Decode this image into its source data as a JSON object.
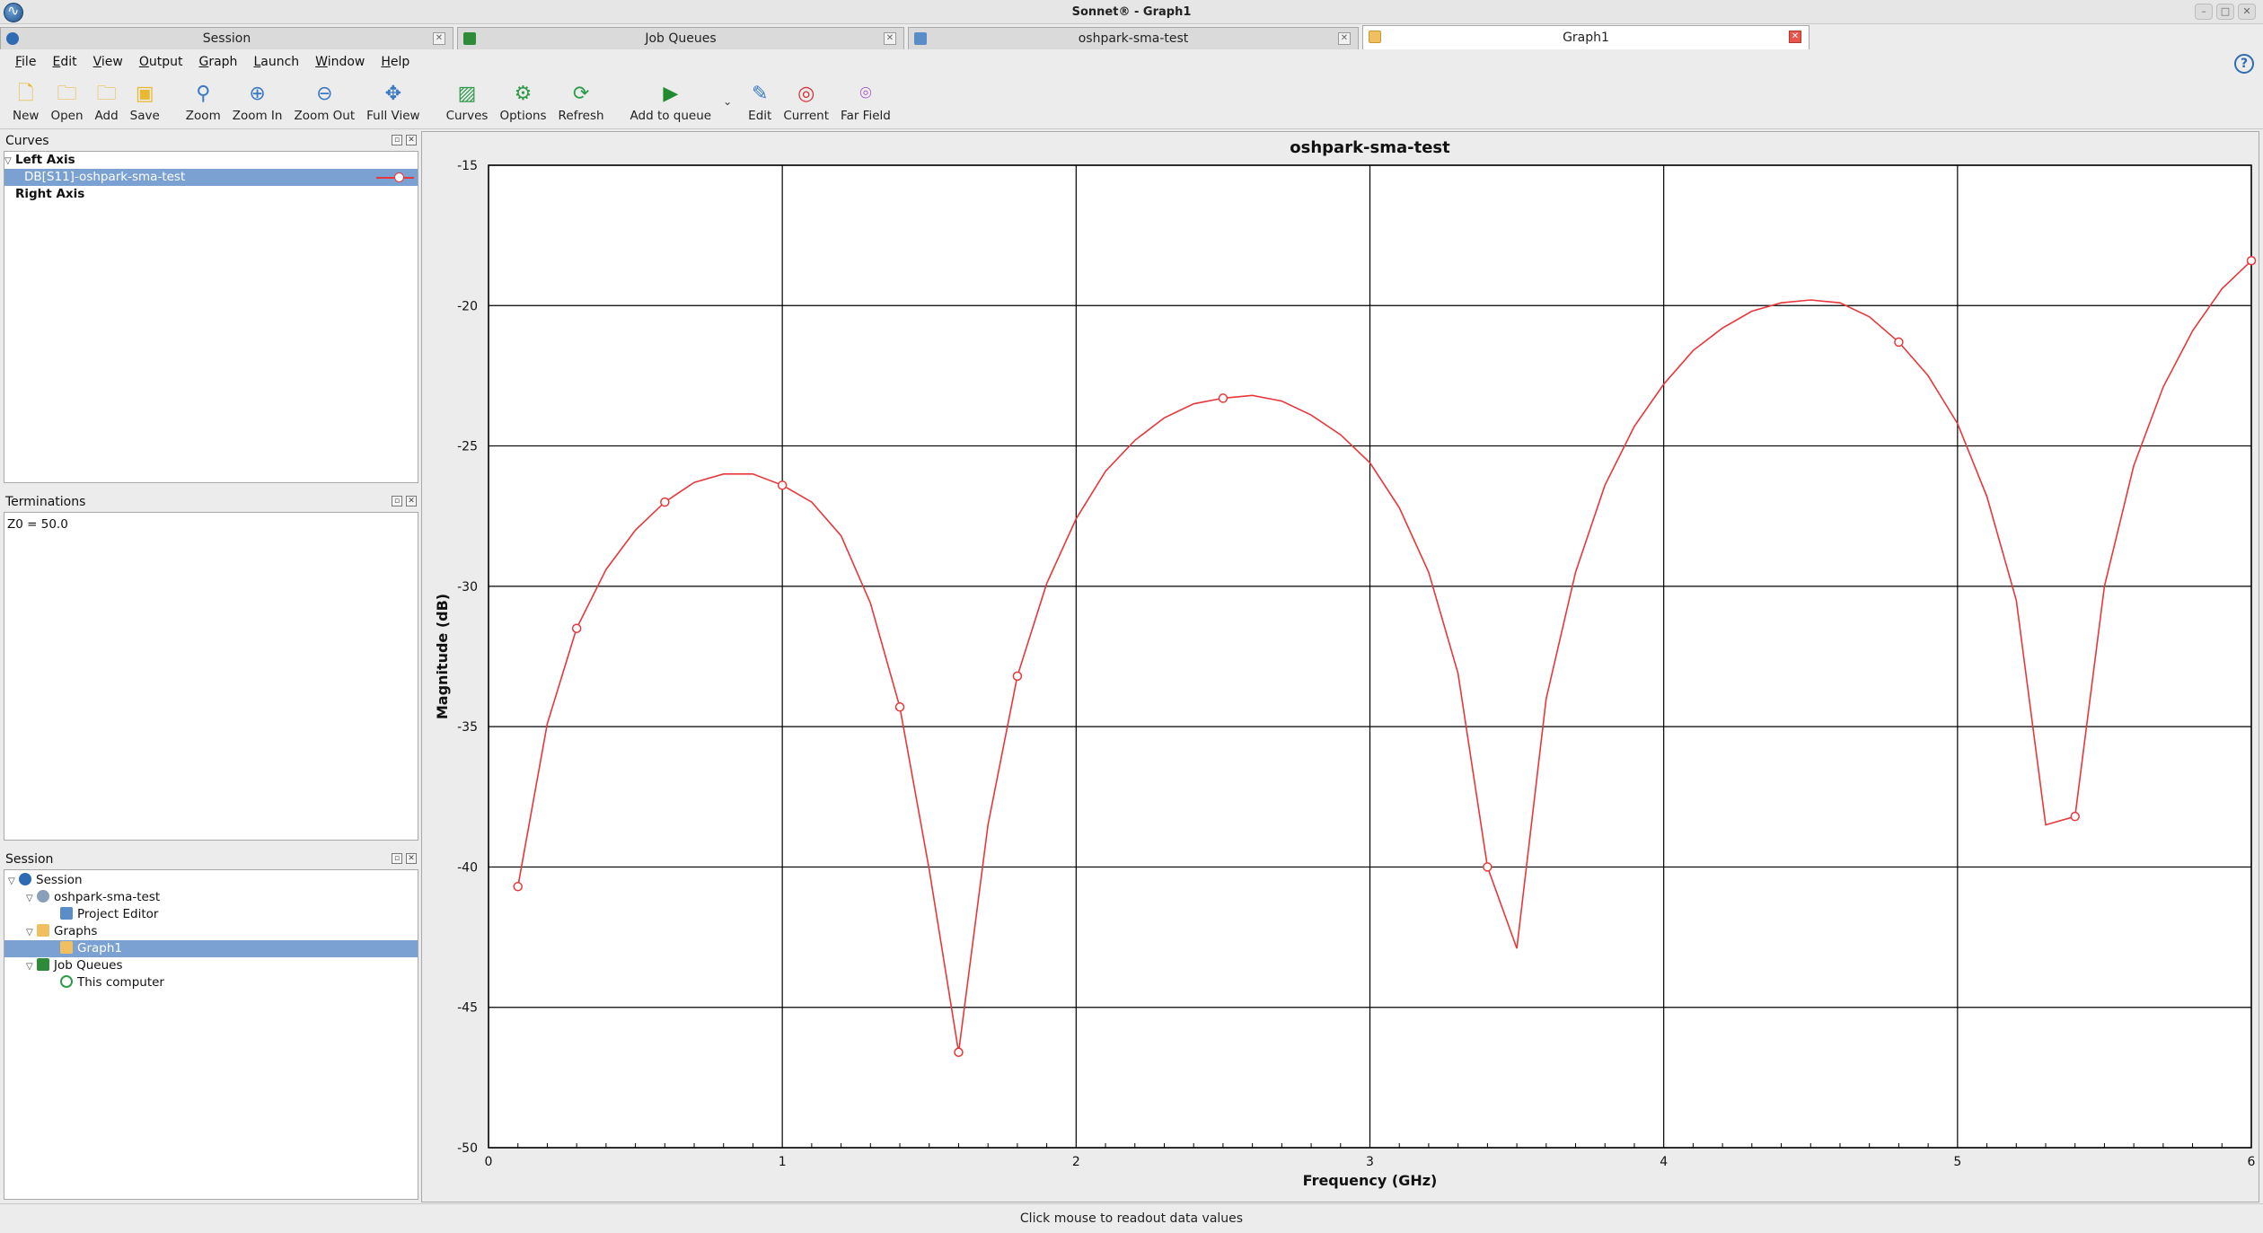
{
  "window": {
    "title": "Sonnet® - Graph1"
  },
  "tabs": [
    {
      "label": "Session",
      "icon": "sonnet-session-icon"
    },
    {
      "label": "Job Queues",
      "icon": "em-queue-icon"
    },
    {
      "label": "oshpark-sma-test",
      "icon": "project-editor-icon"
    },
    {
      "label": "Graph1",
      "icon": "graph-icon",
      "active": true
    }
  ],
  "menu": [
    "File",
    "Edit",
    "View",
    "Output",
    "Graph",
    "Launch",
    "Window",
    "Help"
  ],
  "toolbar": {
    "new": "New",
    "open": "Open",
    "add": "Add",
    "save": "Save",
    "zoom": "Zoom",
    "zoom_in": "Zoom In",
    "zoom_out": "Zoom Out",
    "full_view": "Full View",
    "curves": "Curves",
    "options": "Options",
    "refresh": "Refresh",
    "add_to_queue": "Add to queue",
    "edit": "Edit",
    "current": "Current",
    "far_field": "Far Field"
  },
  "curves_panel": {
    "title": "Curves",
    "left_axis": "Left Axis",
    "curve_name": "DB[S11]-oshpark-sma-test",
    "right_axis": "Right Axis"
  },
  "terminations_panel": {
    "title": "Terminations",
    "value": "Z0 = 50.0"
  },
  "session_panel": {
    "title": "Session",
    "root": "Session",
    "project": "oshpark-sma-test",
    "project_editor": "Project Editor",
    "graphs": "Graphs",
    "graph1": "Graph1",
    "job_queues": "Job Queues",
    "this_computer": "This computer"
  },
  "colors": {
    "curve": "#e8373a",
    "selection": "#7aa1d2",
    "grid": "#000000"
  },
  "chart_data": {
    "type": "line",
    "title": "oshpark-sma-test",
    "xlabel": "Frequency (GHz)",
    "ylabel": "Magnitude (dB)",
    "xlim": [
      0,
      6
    ],
    "ylim": [
      -50,
      -15
    ],
    "xticks": [
      0,
      1,
      2,
      3,
      4,
      5,
      6
    ],
    "yticks": [
      -15,
      -20,
      -25,
      -30,
      -35,
      -40,
      -45,
      -50
    ],
    "grid": true,
    "series": [
      {
        "name": "DB[S11]-oshpark-sma-test",
        "color": "#e8373a",
        "x": [
          0.1,
          0.2,
          0.3,
          0.4,
          0.5,
          0.6,
          0.7,
          0.8,
          0.9,
          1.0,
          1.1,
          1.2,
          1.3,
          1.4,
          1.5,
          1.6,
          1.7,
          1.8,
          1.9,
          2.0,
          2.1,
          2.2,
          2.3,
          2.4,
          2.5,
          2.6,
          2.7,
          2.8,
          2.9,
          3.0,
          3.1,
          3.2,
          3.3,
          3.4,
          3.5,
          3.6,
          3.7,
          3.8,
          3.9,
          4.0,
          4.1,
          4.2,
          4.3,
          4.4,
          4.5,
          4.6,
          4.7,
          4.8,
          4.9,
          5.0,
          5.1,
          5.2,
          5.3,
          5.4,
          5.5,
          5.6,
          5.7,
          5.8,
          5.9,
          6.0
        ],
        "y": [
          -40.7,
          -34.9,
          -31.5,
          -29.4,
          -28.0,
          -27.0,
          -26.3,
          -26.0,
          -26.0,
          -26.4,
          -27.0,
          -28.2,
          -30.6,
          -34.3,
          -40.1,
          -46.6,
          -38.5,
          -33.2,
          -29.9,
          -27.6,
          -25.9,
          -24.8,
          -24.0,
          -23.5,
          -23.3,
          -23.2,
          -23.4,
          -23.9,
          -24.6,
          -25.6,
          -27.2,
          -29.5,
          -33.1,
          -40.0,
          -42.9,
          -34.0,
          -29.5,
          -26.4,
          -24.3,
          -22.8,
          -21.6,
          -20.8,
          -20.2,
          -19.9,
          -19.8,
          -19.9,
          -20.4,
          -21.3,
          -22.5,
          -24.2,
          -26.8,
          -30.5,
          -38.5,
          -38.2,
          -30.0,
          -25.7,
          -22.9,
          -20.9,
          -19.4,
          -18.4
        ],
        "markers_x": [
          0.1,
          0.3,
          0.6,
          1.0,
          1.4,
          1.6,
          1.8,
          2.5,
          3.4,
          4.8,
          5.4,
          6.0
        ]
      }
    ]
  },
  "status": {
    "text": "Click mouse to readout data values"
  }
}
